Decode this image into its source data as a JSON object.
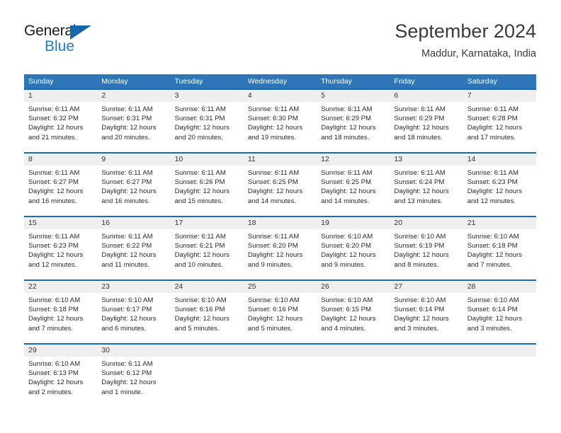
{
  "brand": {
    "name_part1": "General",
    "name_part2": "Blue",
    "triangle_icon": "blue-triangle-icon",
    "accent_color": "#1f7fc4"
  },
  "header": {
    "title": "September 2024",
    "subtitle": "Maddur, Karnataka, India"
  },
  "calendar": {
    "header_bg": "#2e76b8",
    "row_border": "#1d6aad",
    "day_band_bg": "#efefef",
    "weekdays": [
      "Sunday",
      "Monday",
      "Tuesday",
      "Wednesday",
      "Thursday",
      "Friday",
      "Saturday"
    ],
    "weeks": [
      [
        {
          "day": "1",
          "sunrise": "Sunrise: 6:11 AM",
          "sunset": "Sunset: 6:32 PM",
          "daylight1": "Daylight: 12 hours",
          "daylight2": "and 21 minutes."
        },
        {
          "day": "2",
          "sunrise": "Sunrise: 6:11 AM",
          "sunset": "Sunset: 6:31 PM",
          "daylight1": "Daylight: 12 hours",
          "daylight2": "and 20 minutes."
        },
        {
          "day": "3",
          "sunrise": "Sunrise: 6:11 AM",
          "sunset": "Sunset: 6:31 PM",
          "daylight1": "Daylight: 12 hours",
          "daylight2": "and 20 minutes."
        },
        {
          "day": "4",
          "sunrise": "Sunrise: 6:11 AM",
          "sunset": "Sunset: 6:30 PM",
          "daylight1": "Daylight: 12 hours",
          "daylight2": "and 19 minutes."
        },
        {
          "day": "5",
          "sunrise": "Sunrise: 6:11 AM",
          "sunset": "Sunset: 6:29 PM",
          "daylight1": "Daylight: 12 hours",
          "daylight2": "and 18 minutes."
        },
        {
          "day": "6",
          "sunrise": "Sunrise: 6:11 AM",
          "sunset": "Sunset: 6:29 PM",
          "daylight1": "Daylight: 12 hours",
          "daylight2": "and 18 minutes."
        },
        {
          "day": "7",
          "sunrise": "Sunrise: 6:11 AM",
          "sunset": "Sunset: 6:28 PM",
          "daylight1": "Daylight: 12 hours",
          "daylight2": "and 17 minutes."
        }
      ],
      [
        {
          "day": "8",
          "sunrise": "Sunrise: 6:11 AM",
          "sunset": "Sunset: 6:27 PM",
          "daylight1": "Daylight: 12 hours",
          "daylight2": "and 16 minutes."
        },
        {
          "day": "9",
          "sunrise": "Sunrise: 6:11 AM",
          "sunset": "Sunset: 6:27 PM",
          "daylight1": "Daylight: 12 hours",
          "daylight2": "and 16 minutes."
        },
        {
          "day": "10",
          "sunrise": "Sunrise: 6:11 AM",
          "sunset": "Sunset: 6:26 PM",
          "daylight1": "Daylight: 12 hours",
          "daylight2": "and 15 minutes."
        },
        {
          "day": "11",
          "sunrise": "Sunrise: 6:11 AM",
          "sunset": "Sunset: 6:25 PM",
          "daylight1": "Daylight: 12 hours",
          "daylight2": "and 14 minutes."
        },
        {
          "day": "12",
          "sunrise": "Sunrise: 6:11 AM",
          "sunset": "Sunset: 6:25 PM",
          "daylight1": "Daylight: 12 hours",
          "daylight2": "and 14 minutes."
        },
        {
          "day": "13",
          "sunrise": "Sunrise: 6:11 AM",
          "sunset": "Sunset: 6:24 PM",
          "daylight1": "Daylight: 12 hours",
          "daylight2": "and 13 minutes."
        },
        {
          "day": "14",
          "sunrise": "Sunrise: 6:11 AM",
          "sunset": "Sunset: 6:23 PM",
          "daylight1": "Daylight: 12 hours",
          "daylight2": "and 12 minutes."
        }
      ],
      [
        {
          "day": "15",
          "sunrise": "Sunrise: 6:11 AM",
          "sunset": "Sunset: 6:23 PM",
          "daylight1": "Daylight: 12 hours",
          "daylight2": "and 12 minutes."
        },
        {
          "day": "16",
          "sunrise": "Sunrise: 6:11 AM",
          "sunset": "Sunset: 6:22 PM",
          "daylight1": "Daylight: 12 hours",
          "daylight2": "and 11 minutes."
        },
        {
          "day": "17",
          "sunrise": "Sunrise: 6:11 AM",
          "sunset": "Sunset: 6:21 PM",
          "daylight1": "Daylight: 12 hours",
          "daylight2": "and 10 minutes."
        },
        {
          "day": "18",
          "sunrise": "Sunrise: 6:11 AM",
          "sunset": "Sunset: 6:20 PM",
          "daylight1": "Daylight: 12 hours",
          "daylight2": "and 9 minutes."
        },
        {
          "day": "19",
          "sunrise": "Sunrise: 6:10 AM",
          "sunset": "Sunset: 6:20 PM",
          "daylight1": "Daylight: 12 hours",
          "daylight2": "and 9 minutes."
        },
        {
          "day": "20",
          "sunrise": "Sunrise: 6:10 AM",
          "sunset": "Sunset: 6:19 PM",
          "daylight1": "Daylight: 12 hours",
          "daylight2": "and 8 minutes."
        },
        {
          "day": "21",
          "sunrise": "Sunrise: 6:10 AM",
          "sunset": "Sunset: 6:18 PM",
          "daylight1": "Daylight: 12 hours",
          "daylight2": "and 7 minutes."
        }
      ],
      [
        {
          "day": "22",
          "sunrise": "Sunrise: 6:10 AM",
          "sunset": "Sunset: 6:18 PM",
          "daylight1": "Daylight: 12 hours",
          "daylight2": "and 7 minutes."
        },
        {
          "day": "23",
          "sunrise": "Sunrise: 6:10 AM",
          "sunset": "Sunset: 6:17 PM",
          "daylight1": "Daylight: 12 hours",
          "daylight2": "and 6 minutes."
        },
        {
          "day": "24",
          "sunrise": "Sunrise: 6:10 AM",
          "sunset": "Sunset: 6:16 PM",
          "daylight1": "Daylight: 12 hours",
          "daylight2": "and 5 minutes."
        },
        {
          "day": "25",
          "sunrise": "Sunrise: 6:10 AM",
          "sunset": "Sunset: 6:16 PM",
          "daylight1": "Daylight: 12 hours",
          "daylight2": "and 5 minutes."
        },
        {
          "day": "26",
          "sunrise": "Sunrise: 6:10 AM",
          "sunset": "Sunset: 6:15 PM",
          "daylight1": "Daylight: 12 hours",
          "daylight2": "and 4 minutes."
        },
        {
          "day": "27",
          "sunrise": "Sunrise: 6:10 AM",
          "sunset": "Sunset: 6:14 PM",
          "daylight1": "Daylight: 12 hours",
          "daylight2": "and 3 minutes."
        },
        {
          "day": "28",
          "sunrise": "Sunrise: 6:10 AM",
          "sunset": "Sunset: 6:14 PM",
          "daylight1": "Daylight: 12 hours",
          "daylight2": "and 3 minutes."
        }
      ],
      [
        {
          "day": "29",
          "sunrise": "Sunrise: 6:10 AM",
          "sunset": "Sunset: 6:13 PM",
          "daylight1": "Daylight: 12 hours",
          "daylight2": "and 2 minutes."
        },
        {
          "day": "30",
          "sunrise": "Sunrise: 6:11 AM",
          "sunset": "Sunset: 6:12 PM",
          "daylight1": "Daylight: 12 hours",
          "daylight2": "and 1 minute."
        },
        {
          "day": "",
          "sunrise": "",
          "sunset": "",
          "daylight1": "",
          "daylight2": ""
        },
        {
          "day": "",
          "sunrise": "",
          "sunset": "",
          "daylight1": "",
          "daylight2": ""
        },
        {
          "day": "",
          "sunrise": "",
          "sunset": "",
          "daylight1": "",
          "daylight2": ""
        },
        {
          "day": "",
          "sunrise": "",
          "sunset": "",
          "daylight1": "",
          "daylight2": ""
        },
        {
          "day": "",
          "sunrise": "",
          "sunset": "",
          "daylight1": "",
          "daylight2": ""
        }
      ]
    ]
  }
}
